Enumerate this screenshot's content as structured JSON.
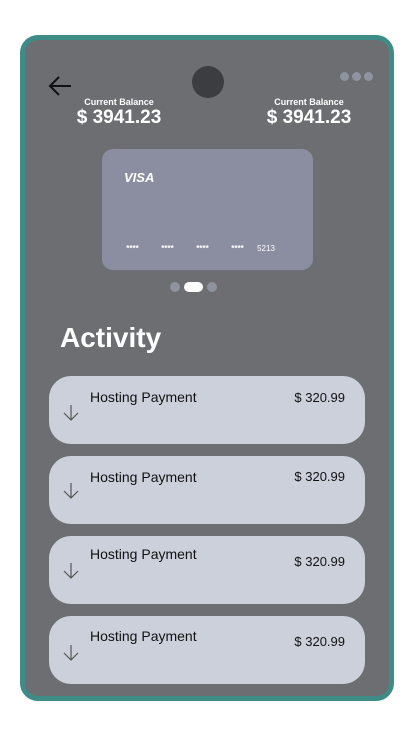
{
  "balance_left": {
    "label": "Current Balance",
    "amount": "$ 3941.23"
  },
  "balance_right": {
    "label": "Current Balance",
    "amount": "$ 3941.23"
  },
  "card": {
    "brand": "VISA",
    "groups": [
      "****",
      "****",
      "****",
      "****"
    ],
    "last4": "5213"
  },
  "carousel": {
    "count": 3,
    "active_index": 1
  },
  "activity": {
    "title": "Activity",
    "items": [
      {
        "name": "Hosting Payment",
        "amount": "$ 320.99",
        "icon": "arrow-down-icon"
      },
      {
        "name": "Hosting Payment",
        "amount": "$ 320.99",
        "icon": "arrow-down-icon"
      },
      {
        "name": "Hosting Payment",
        "amount": "$ 320.99",
        "icon": "arrow-down-icon"
      },
      {
        "name": "Hosting Payment",
        "amount": "$ 320.99",
        "icon": "arrow-down-icon"
      }
    ]
  },
  "colors": {
    "frame": "#3f8c86",
    "screen": "#6c6e72",
    "card": "#8b8ea0",
    "item": "#cbd0db"
  }
}
